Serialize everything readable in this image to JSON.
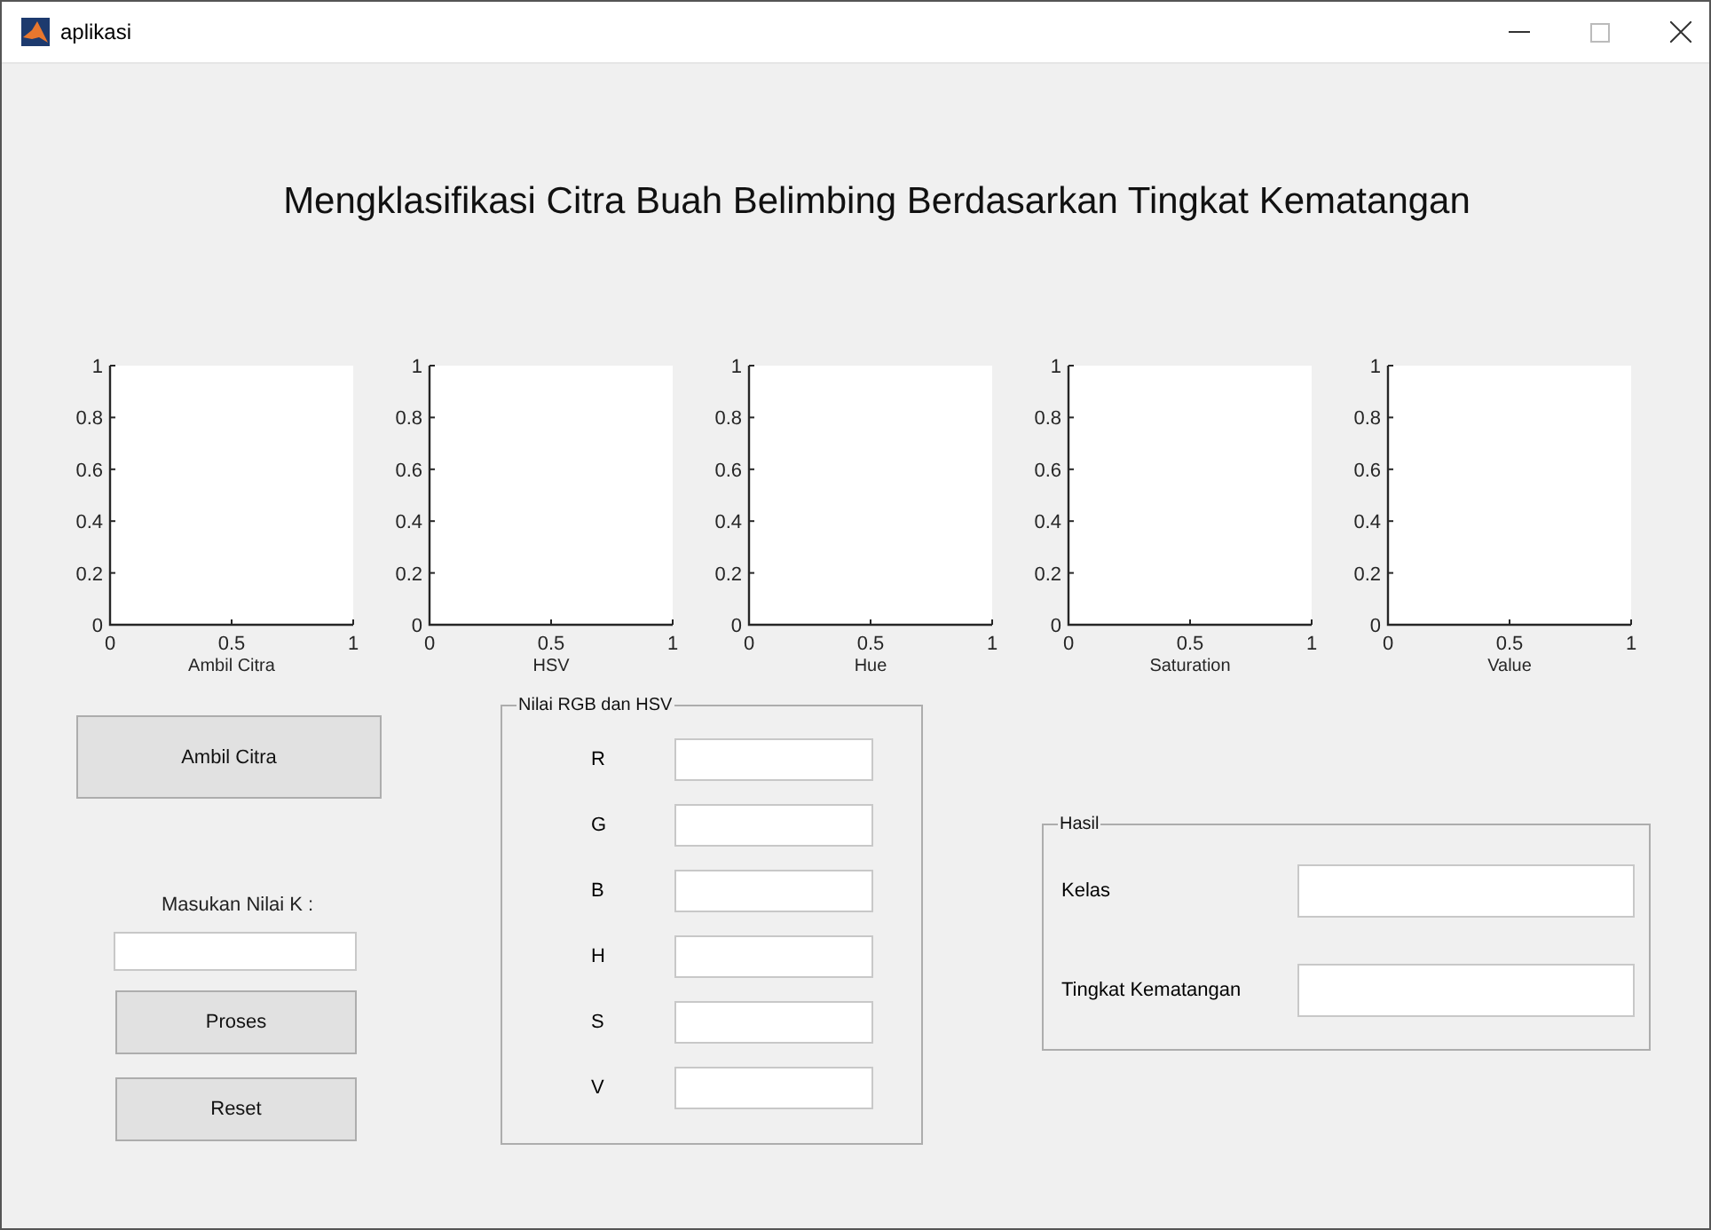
{
  "window": {
    "title": "aplikasi"
  },
  "heading": "Mengklasifikasi Citra Buah Belimbing Berdasarkan Tingkat Kematangan",
  "plots": [
    {
      "xlabel": "Ambil Citra",
      "xticks": [
        "0",
        "0.5",
        "1"
      ],
      "yticks": [
        "1",
        "0.8",
        "0.6",
        "0.4",
        "0.2",
        "0"
      ]
    },
    {
      "xlabel": "HSV",
      "xticks": [
        "0",
        "0.5",
        "1"
      ],
      "yticks": [
        "1",
        "0.8",
        "0.6",
        "0.4",
        "0.2",
        "0"
      ]
    },
    {
      "xlabel": "Hue",
      "xticks": [
        "0",
        "0.5",
        "1"
      ],
      "yticks": [
        "1",
        "0.8",
        "0.6",
        "0.4",
        "0.2",
        "0"
      ]
    },
    {
      "xlabel": "Saturation",
      "xticks": [
        "0",
        "0.5",
        "1"
      ],
      "yticks": [
        "1",
        "0.8",
        "0.6",
        "0.4",
        "0.2",
        "0"
      ]
    },
    {
      "xlabel": "Value",
      "xticks": [
        "0",
        "0.5",
        "1"
      ],
      "yticks": [
        "1",
        "0.8",
        "0.6",
        "0.4",
        "0.2",
        "0"
      ]
    }
  ],
  "load_button": "Ambil Citra",
  "k_input": {
    "label": "Masukan Nilai K :"
  },
  "process_button": "Proses",
  "reset_button": "Reset",
  "rgb_hsv_group": {
    "title": "Nilai RGB dan HSV",
    "fields": [
      {
        "label": "R"
      },
      {
        "label": "G"
      },
      {
        "label": "B"
      },
      {
        "label": "H"
      },
      {
        "label": "S"
      },
      {
        "label": "V"
      }
    ]
  },
  "result_group": {
    "title": "Hasil",
    "fields": [
      {
        "label": "Kelas"
      },
      {
        "label": "Tingkat Kematangan"
      }
    ]
  }
}
